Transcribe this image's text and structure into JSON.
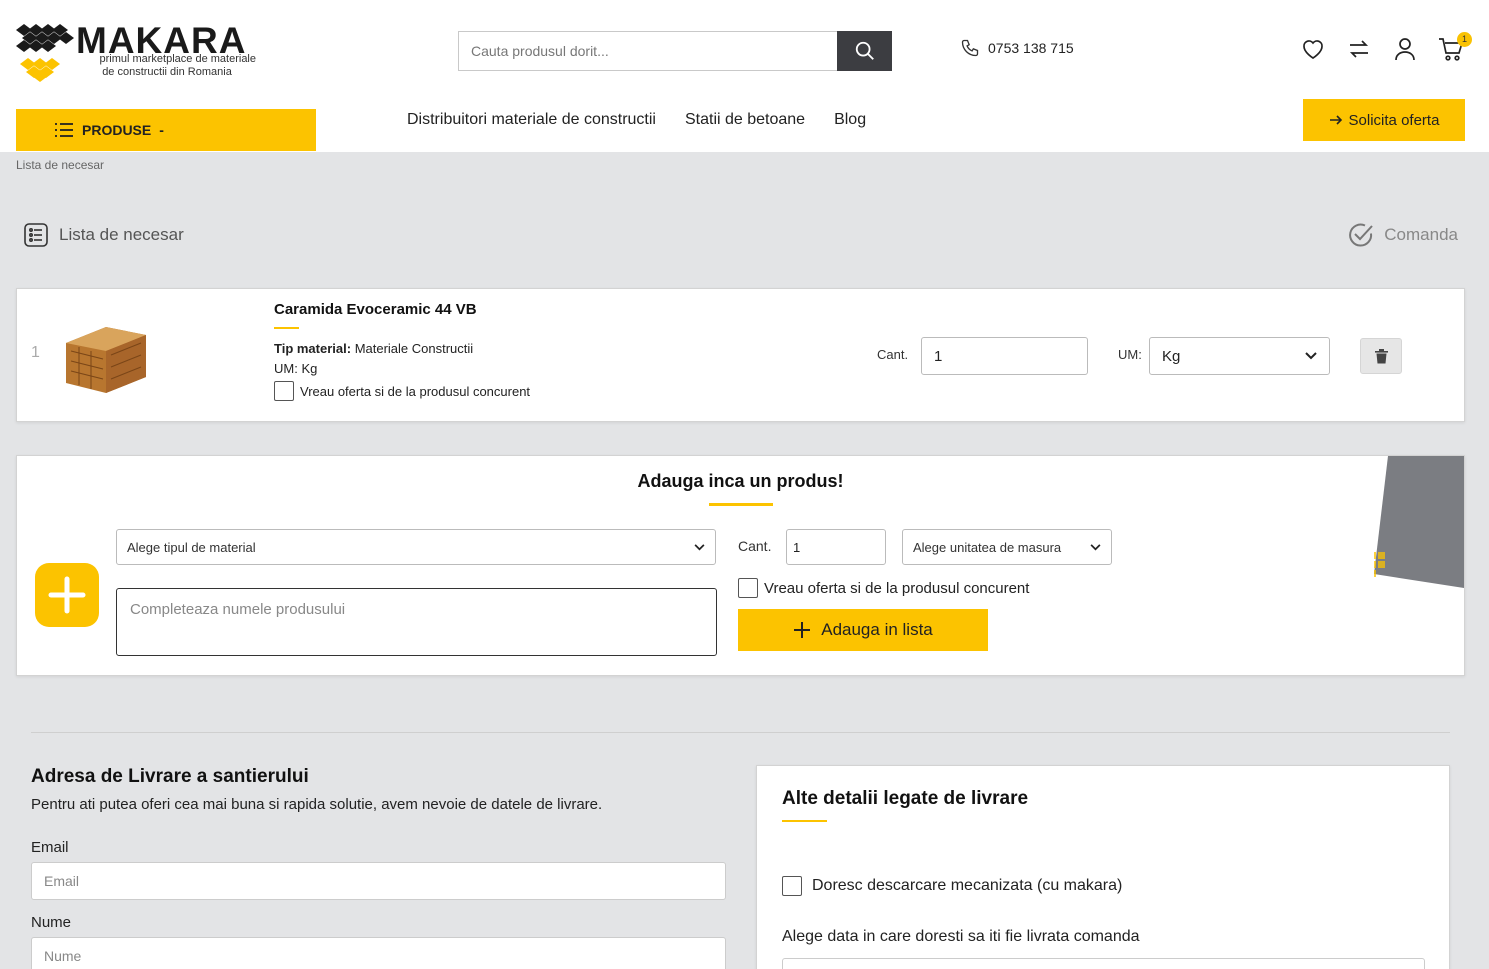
{
  "brand": {
    "name": "MAKARA",
    "tagline_1": "primul marketplace de materiale",
    "tagline_2": "de constructii din Romania"
  },
  "search": {
    "placeholder": "Cauta produsul dorit..."
  },
  "phone": "0753 138 715",
  "cart": {
    "count": "1"
  },
  "nav": {
    "produse": "PRODUSE",
    "produse_caret": "-",
    "links": [
      "Distribuitori materiale de constructii",
      "Statii de betoane",
      "Blog"
    ],
    "oferta": "Solicita oferta"
  },
  "breadcrumb": "Lista de necesar",
  "steps": {
    "left": "Lista de necesar",
    "right": "Comanda"
  },
  "product": {
    "index": "1",
    "title": "Caramida Evoceramic 44 VB",
    "tip_label": "Tip material:",
    "tip_value": "Materiale Constructii",
    "um_line": "UM: Kg",
    "check_label": "Vreau oferta si de la produsul concurent",
    "cant_label": "Cant.",
    "cant_value": "1",
    "um_label": "UM:",
    "um_value": "Kg"
  },
  "add": {
    "title": "Adauga inca un produs!",
    "type_placeholder": "Alege tipul de material",
    "name_placeholder": "Completeaza numele produsului",
    "cant_label": "Cant.",
    "cant_value": "1",
    "um_placeholder": "Alege unitatea de masura",
    "check_label": "Vreau oferta si de la produsul concurent",
    "button": "Adauga in lista"
  },
  "delivery": {
    "title": "Adresa de Livrare a santierului",
    "subtitle": "Pentru ati putea oferi cea mai buna si rapida solutie, avem nevoie de datele de livrare.",
    "email_label": "Email",
    "email_placeholder": "Email",
    "name_label": "Nume",
    "name_placeholder": "Nume"
  },
  "other": {
    "title": "Alte detalii legate de livrare",
    "check_label": "Doresc descarcare mecanizata (cu makara)",
    "date_label": "Alege data in care doresti sa iti fie livrata comanda"
  },
  "colors": {
    "accent": "#fcc300",
    "dark": "#3c3d41",
    "background": "#e3e4e6"
  }
}
